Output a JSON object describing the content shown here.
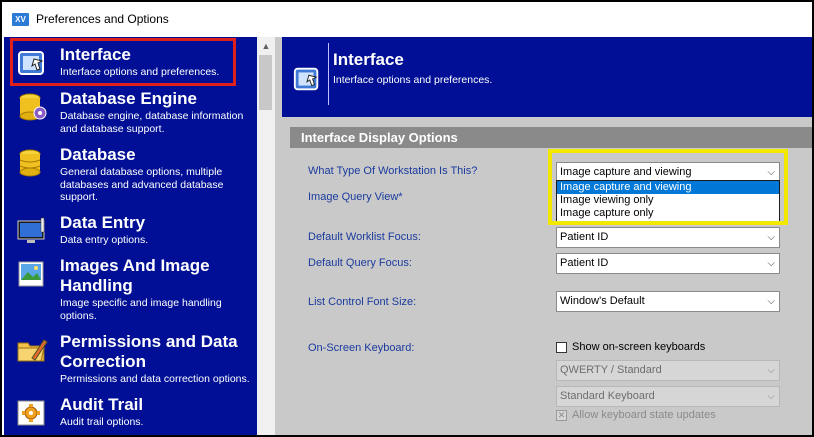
{
  "window": {
    "title": "Preferences and Options",
    "app_icon_text": "XV"
  },
  "sidebar": {
    "items": [
      {
        "title": "Interface",
        "desc": "Interface options and preferences.",
        "icon": "interface-icon"
      },
      {
        "title": "Database Engine",
        "desc": "Database engine, database information and database support.",
        "icon": "database-engine-icon"
      },
      {
        "title": "Database",
        "desc": "General database options, multiple databases and advanced database support.",
        "icon": "database-icon"
      },
      {
        "title": "Data Entry",
        "desc": "Data entry options.",
        "icon": "monitor-icon"
      },
      {
        "title": "Images And Image Handling",
        "desc": "Image specific and image handling options.",
        "icon": "image-icon"
      },
      {
        "title": "Permissions and Data Correction",
        "desc": "Permissions and data correction options.",
        "icon": "folder-pencil-icon"
      },
      {
        "title": "Audit Trail",
        "desc": "Audit trail options.",
        "icon": "audit-trail-icon"
      }
    ]
  },
  "header": {
    "title": "Interface",
    "subtitle": "Interface options and preferences."
  },
  "section": {
    "title": "Interface Display Options"
  },
  "fields": {
    "workstation": {
      "label": "What Type Of Workstation Is This?",
      "value": "Image capture and viewing"
    },
    "image_query_view": {
      "label": "Image Query View*"
    },
    "worklist_focus": {
      "label": "Default Worklist Focus:",
      "value": "Patient ID"
    },
    "query_focus": {
      "label": "Default Query Focus:",
      "value": "Patient ID"
    },
    "font_size": {
      "label": "List Control Font Size:",
      "value": "Window's Default"
    },
    "keyboard": {
      "label": "On-Screen Keyboard:",
      "show_label": "Show on-screen keyboards",
      "layout_value": "QWERTY / Standard",
      "type_value": "Standard Keyboard",
      "allow_label": "Allow keyboard state updates"
    }
  },
  "dropdown": {
    "options": [
      "Image capture and viewing",
      "Image viewing only",
      "Image capture only"
    ],
    "selected_index": 0
  },
  "colors": {
    "sidebar_bg": "#000f95",
    "selection_outline": "#e0201a",
    "callout_outline": "#f5e800",
    "field_label": "#1a3b9e",
    "list_selected": "#0078d7"
  }
}
